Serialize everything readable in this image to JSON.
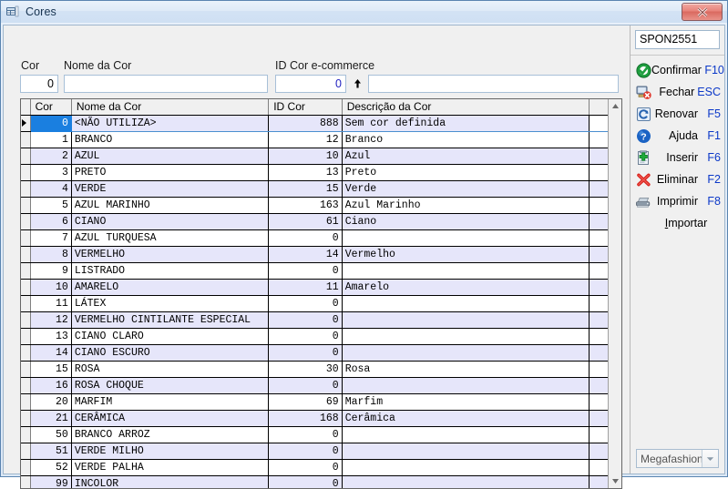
{
  "window": {
    "title": "Cores",
    "icon": "grid-window-icon",
    "close_label": "x"
  },
  "form": {
    "fields": [
      {
        "label": "Cor",
        "value": "0",
        "name": "cor-field"
      },
      {
        "label": "Nome da Cor",
        "value": "",
        "name": "nome-da-cor-field"
      },
      {
        "label": "ID Cor e-commerce",
        "value": "0",
        "name": "id-cor-ecommerce-field"
      },
      {
        "label": "",
        "value": "",
        "name": "descricao-field"
      }
    ],
    "spinner": "up-arrow-icon"
  },
  "grid": {
    "columns": [
      "Cor",
      "Nome da Cor",
      "ID Cor",
      "Descrição da Cor"
    ],
    "selected_row_index": 0,
    "rows": [
      {
        "cor": "0",
        "nome": "<NÃO UTILIZA>",
        "id": "888",
        "desc": "Sem cor definida"
      },
      {
        "cor": "1",
        "nome": "BRANCO",
        "id": "12",
        "desc": "Branco"
      },
      {
        "cor": "2",
        "nome": "AZUL",
        "id": "10",
        "desc": "Azul"
      },
      {
        "cor": "3",
        "nome": "PRETO",
        "id": "13",
        "desc": "Preto"
      },
      {
        "cor": "4",
        "nome": "VERDE",
        "id": "15",
        "desc": "Verde"
      },
      {
        "cor": "5",
        "nome": "AZUL MARINHO",
        "id": "163",
        "desc": "Azul Marinho"
      },
      {
        "cor": "6",
        "nome": "CIANO",
        "id": "61",
        "desc": "Ciano"
      },
      {
        "cor": "7",
        "nome": "AZUL TURQUESA",
        "id": "0",
        "desc": ""
      },
      {
        "cor": "8",
        "nome": "VERMELHO",
        "id": "14",
        "desc": "Vermelho"
      },
      {
        "cor": "9",
        "nome": "LISTRADO",
        "id": "0",
        "desc": ""
      },
      {
        "cor": "10",
        "nome": "AMARELO",
        "id": "11",
        "desc": "Amarelo"
      },
      {
        "cor": "11",
        "nome": "LÁTEX",
        "id": "0",
        "desc": ""
      },
      {
        "cor": "12",
        "nome": "VERMELHO CINTILANTE ESPECIAL",
        "id": "0",
        "desc": ""
      },
      {
        "cor": "13",
        "nome": "CIANO CLARO",
        "id": "0",
        "desc": ""
      },
      {
        "cor": "14",
        "nome": "CIANO ESCURO",
        "id": "0",
        "desc": ""
      },
      {
        "cor": "15",
        "nome": "ROSA",
        "id": "30",
        "desc": "Rosa"
      },
      {
        "cor": "16",
        "nome": "ROSA CHOQUE",
        "id": "0",
        "desc": ""
      },
      {
        "cor": "20",
        "nome": "MARFIM",
        "id": "69",
        "desc": "Marfim"
      },
      {
        "cor": "21",
        "nome": "CERÂMICA",
        "id": "168",
        "desc": "Cerâmica"
      },
      {
        "cor": "50",
        "nome": "BRANCO ARROZ",
        "id": "0",
        "desc": ""
      },
      {
        "cor": "51",
        "nome": "VERDE MILHO",
        "id": "0",
        "desc": ""
      },
      {
        "cor": "52",
        "nome": "VERDE PALHA",
        "id": "0",
        "desc": ""
      },
      {
        "cor": "99",
        "nome": "INCOLOR",
        "id": "0",
        "desc": ""
      }
    ]
  },
  "scrollbar": {
    "up": "scroll-up-arrow-icon",
    "down": "scroll-down-arrow-icon"
  },
  "sidebar": {
    "record_id": "SPON2551",
    "buttons": [
      {
        "label": "Confirmar",
        "key": "F10",
        "icon": "check-circle-icon",
        "name": "confirmar-button"
      },
      {
        "label": "Fechar",
        "key": "ESC",
        "icon": "close-window-icon",
        "name": "fechar-button"
      },
      {
        "label": "Renovar",
        "key": "F5",
        "icon": "refresh-icon",
        "name": "renovar-button"
      },
      {
        "label": "Ajuda",
        "key": "F1",
        "icon": "help-circle-icon",
        "name": "ajuda-button"
      },
      {
        "label": "Inserir",
        "key": "F6",
        "icon": "add-document-icon",
        "name": "inserir-button"
      },
      {
        "label": "Eliminar",
        "key": "F2",
        "icon": "red-x-icon",
        "name": "eliminar-button"
      },
      {
        "label": "Imprimir",
        "key": "F8",
        "icon": "printer-icon",
        "name": "imprimir-button"
      }
    ],
    "import": {
      "accel": "I",
      "rest": "mportar"
    },
    "company_combo": {
      "value": "Megafashion",
      "arrow": "chevron-down-icon"
    }
  },
  "colors": {
    "title_bar": "#d3e2f4",
    "selection": "#1a7fe0",
    "alt_row": "#e6e6fa",
    "key_text": "#0b38c8",
    "close_button": "#d9695f"
  }
}
